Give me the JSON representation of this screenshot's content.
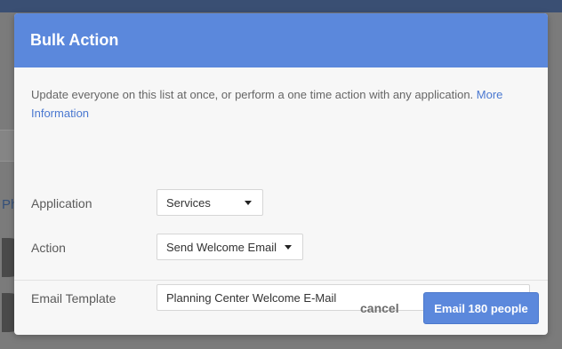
{
  "background": {
    "partial_text": "Ph"
  },
  "modal": {
    "title": "Bulk Action",
    "intro_text": "Update everyone on this list at once, or perform a one time action with any application.",
    "more_info_link": "More Information",
    "fields": {
      "application": {
        "label": "Application",
        "value": "Services"
      },
      "action": {
        "label": "Action",
        "value": "Send Welcome Email"
      },
      "email_template": {
        "label": "Email Template",
        "value": "Planning Center Welcome E-Mail"
      }
    },
    "footer": {
      "cancel_label": "cancel",
      "submit_label": "Email 180 people"
    }
  },
  "colors": {
    "header": "#5b88dc",
    "link": "#4a78d0",
    "primary_button": "#5b88dc"
  },
  "icons": {
    "select_caret": "caret-down-icon"
  }
}
